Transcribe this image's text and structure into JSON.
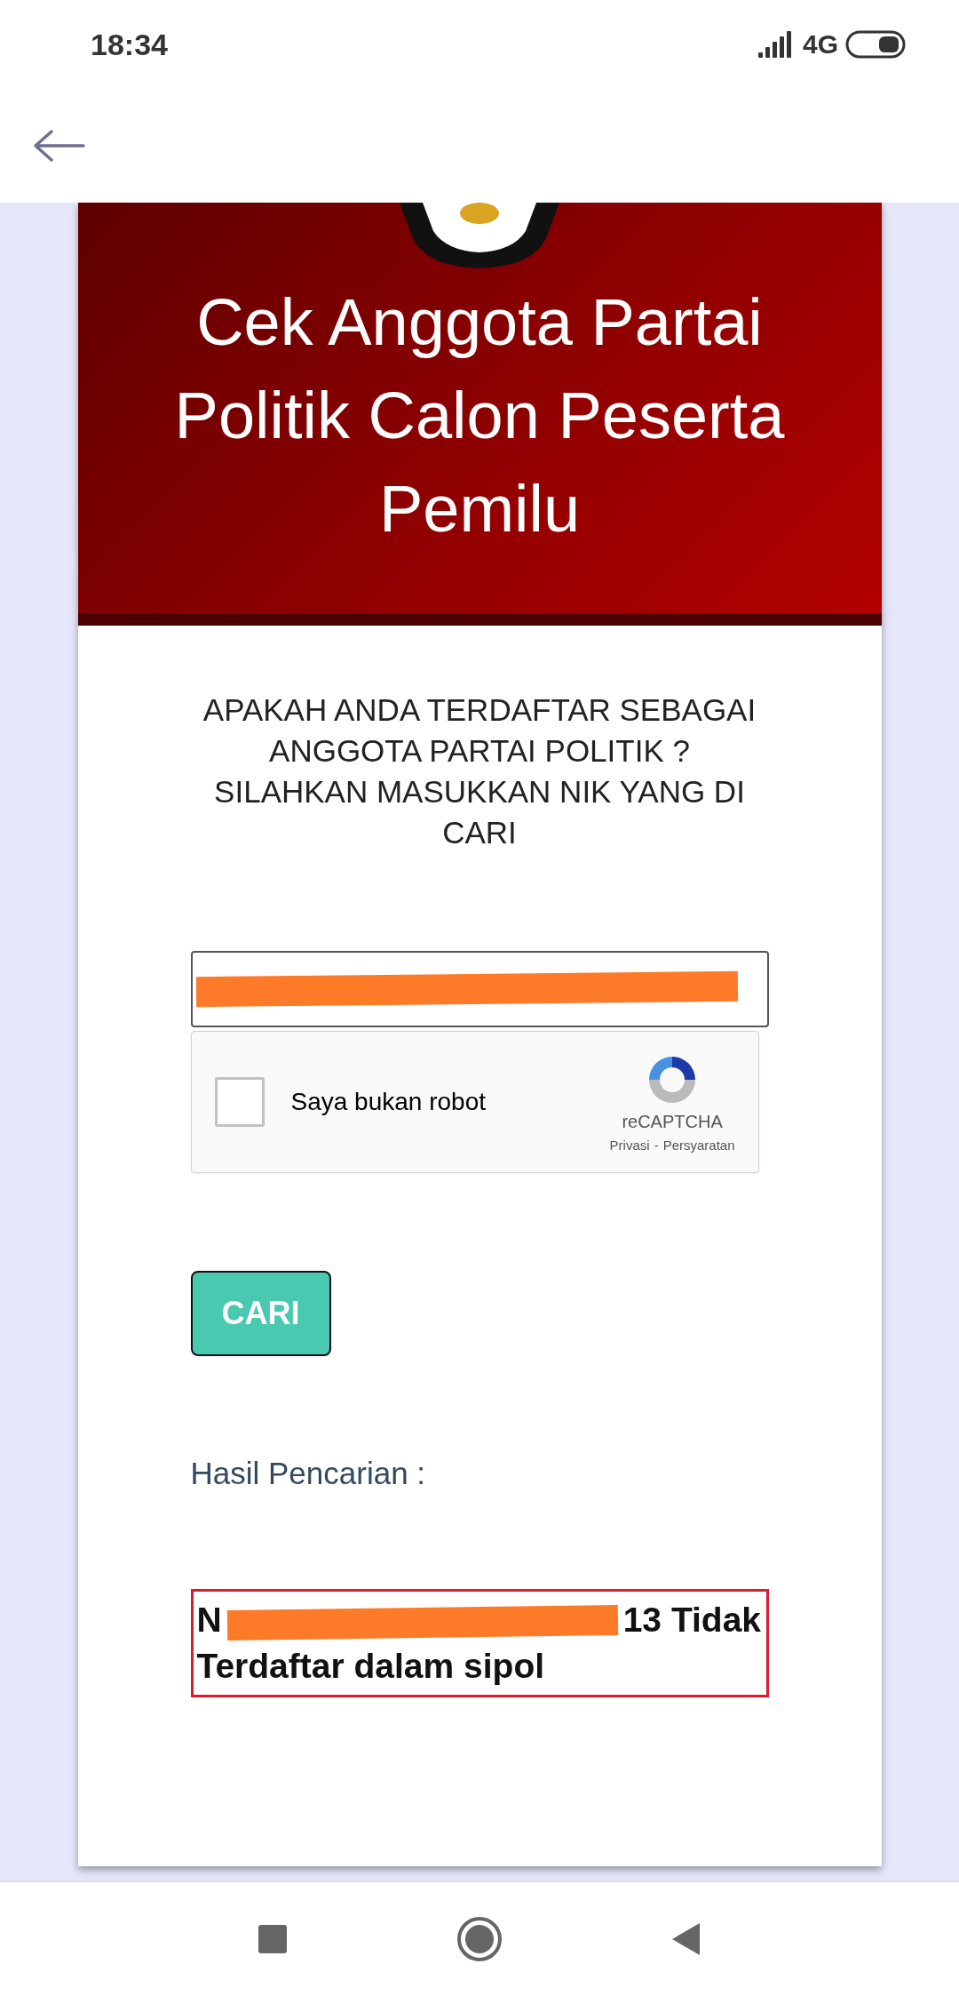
{
  "status_bar": {
    "time": "18:34",
    "network": "4G"
  },
  "header": {
    "title": "Cek Anggota Partai Politik Calon Peserta Pemilu"
  },
  "form": {
    "question": "APAKAH ANDA TERDAFTAR SEBAGAI ANGGOTA PARTAI POLITIK ? SILAHKAN MASUKKAN NIK YANG DI CARI",
    "nik_field": {
      "redacted": true
    },
    "captcha": {
      "label": "Saya bukan robot",
      "checked": false,
      "brand": "reCAPTCHA",
      "links": [
        "Privasi",
        "Persyaratan"
      ],
      "separator": "-"
    },
    "search_button": "CARI"
  },
  "result": {
    "label": "Hasil Pencarian :",
    "prefix": "N",
    "suffix": "13 Tidak Terdaftar dalam sipol",
    "redacted": true
  }
}
